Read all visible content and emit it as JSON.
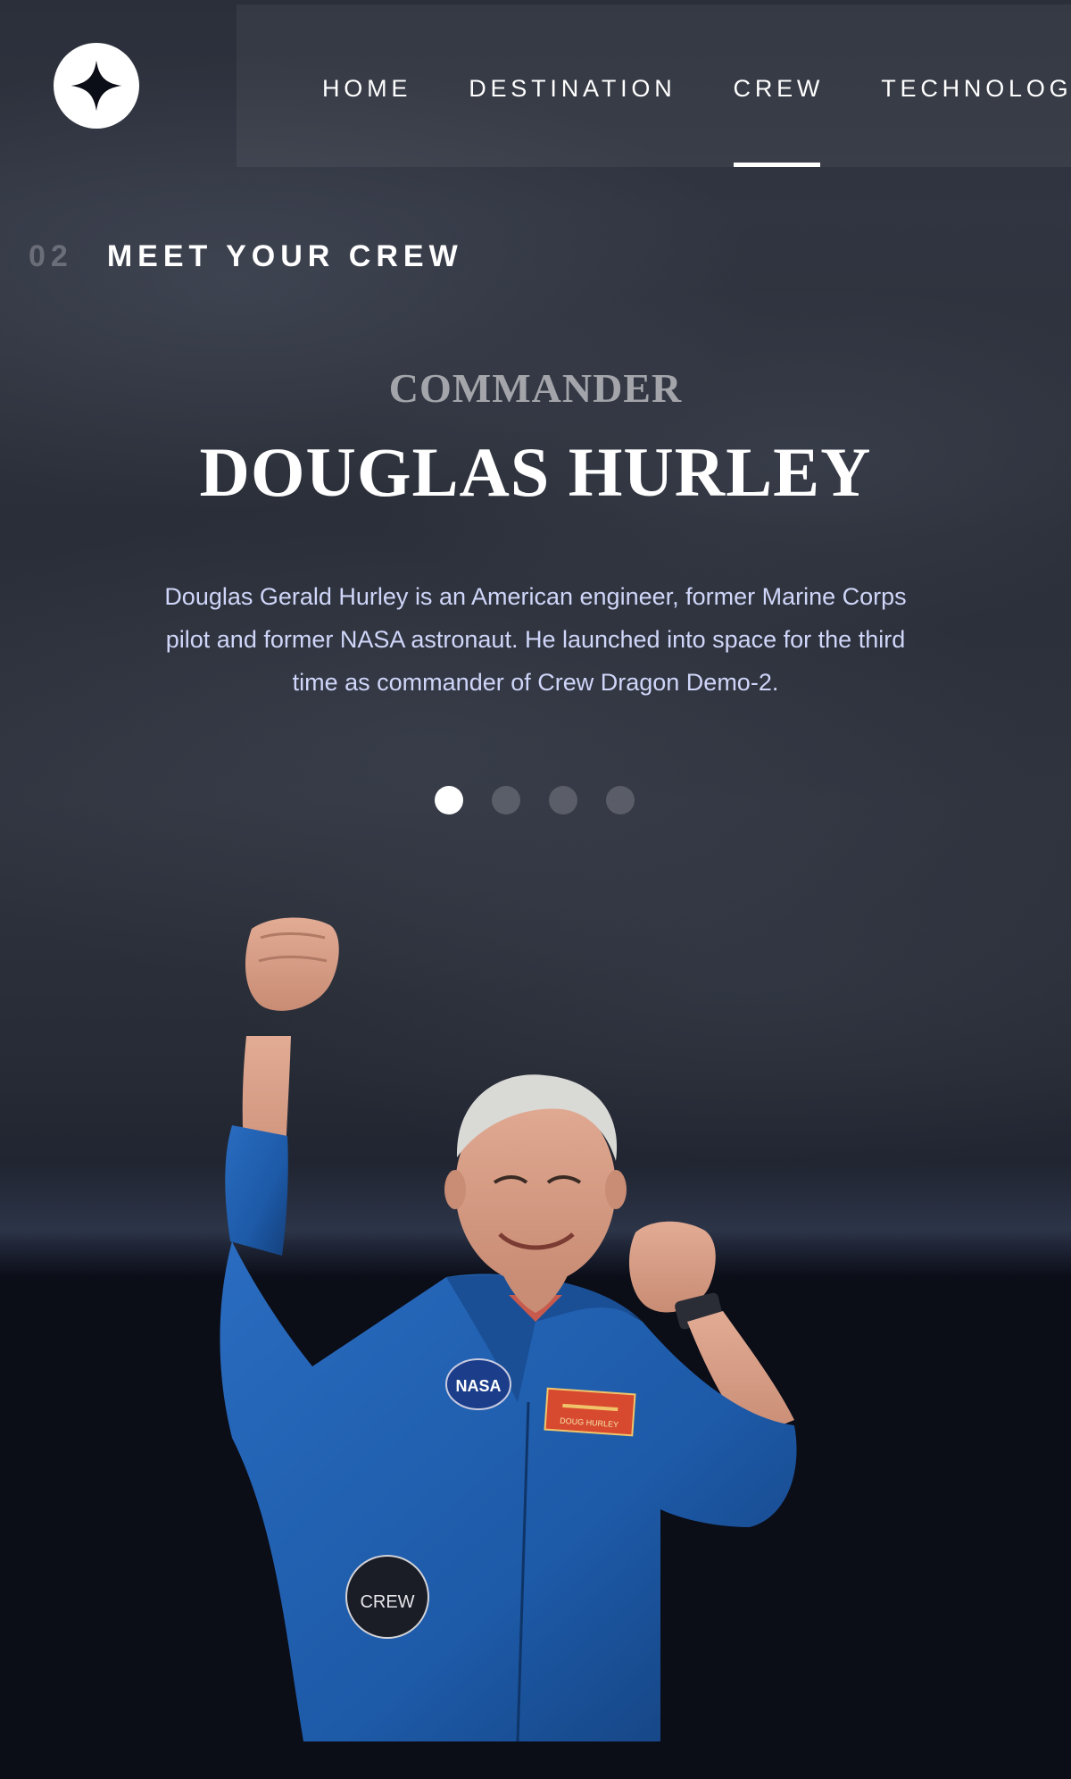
{
  "header": {
    "logo_icon": "star-logo-icon",
    "nav": [
      {
        "number": "",
        "label": "HOME",
        "active": false
      },
      {
        "number": "",
        "label": "DESTINATION",
        "active": false
      },
      {
        "number": "",
        "label": "CREW",
        "active": true
      },
      {
        "number": "",
        "label": "TECHNOLOGY",
        "active": false
      }
    ]
  },
  "section": {
    "number": "02",
    "title": "MEET YOUR CREW"
  },
  "crew": {
    "role": "COMMANDER",
    "name": "DOUGLAS HURLEY",
    "bio": "Douglas Gerald Hurley is an American engineer, former Marine Corps pilot and former NASA astronaut. He launched into space for the third time as commander of Crew Dragon Demo-2.",
    "image_icon": "astronaut-photo",
    "patches": {
      "agency": "NASA",
      "name_tag": "DOUG HURLEY",
      "mission": "CREW"
    }
  },
  "pagination": {
    "count": 4,
    "active_index": 0
  },
  "colors": {
    "background": "#0b0d17",
    "text": "#ffffff",
    "accent_light": "#d0d6f9",
    "suit_blue": "#1d5aa8"
  }
}
